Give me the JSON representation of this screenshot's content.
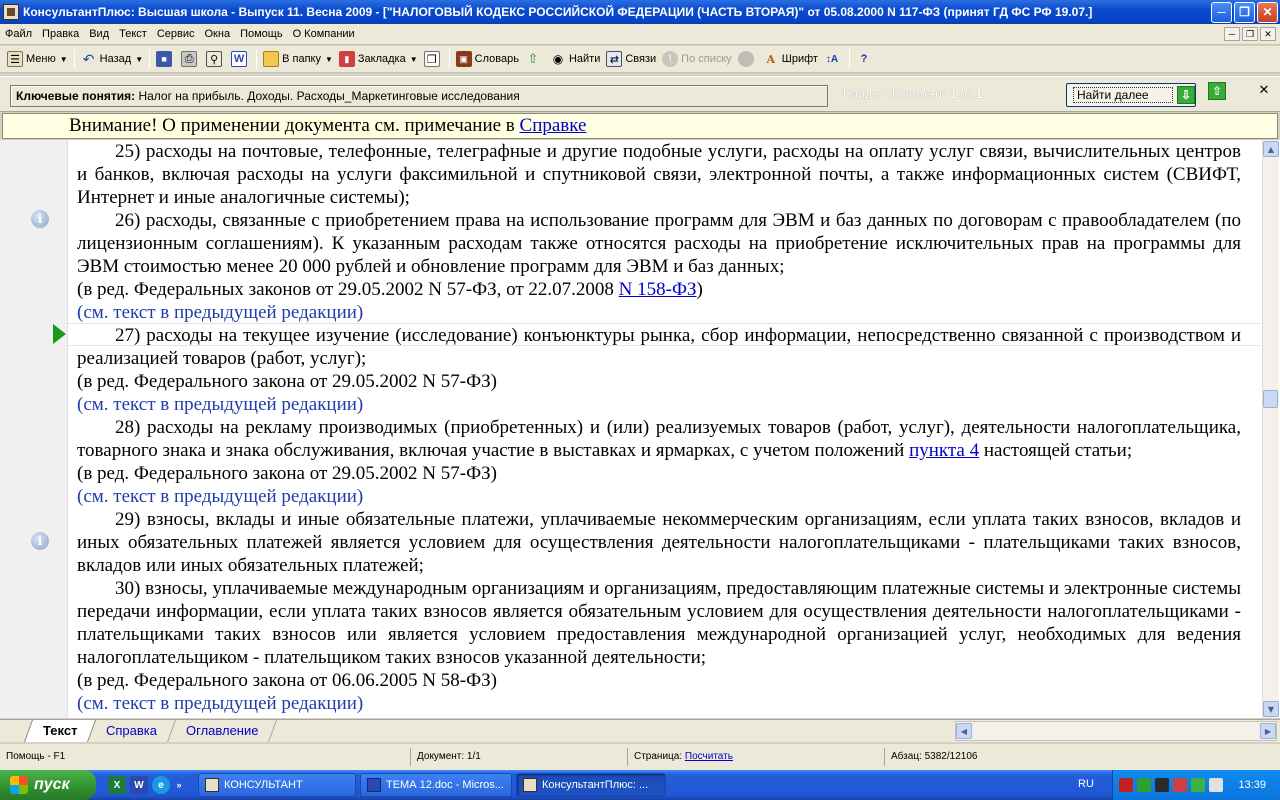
{
  "window": {
    "title": "КонсультантПлюс: Высшая школа - Выпуск 11. Весна 2009 - [\"НАЛОГОВЫЙ КОДЕКС РОССИЙСКОЙ ФЕДЕРАЦИИ (ЧАСТЬ ВТОРАЯ)\" от 05.08.2000 N 117-ФЗ (принят ГД ФС РФ 19.07.]"
  },
  "menu": [
    "Файл",
    "Правка",
    "Вид",
    "Текст",
    "Сервис",
    "Окна",
    "Помощь",
    "О Компании"
  ],
  "toolbar": {
    "menu": "Меню",
    "back": "Назад",
    "to_folder": "В папку",
    "bookmark": "Закладка",
    "dictionary": "Словарь",
    "find": "Найти",
    "links": "Связи",
    "by_list": "По списку",
    "font": "Шрифт"
  },
  "search": {
    "label": "Ключевые понятия:",
    "query": "Налог на прибыль. Доходы. Расходы_Маркетинговые исследования",
    "found_prefix": "Найден фрагмент:",
    "found_current": "1",
    "found_of": "из",
    "found_total": "1",
    "find_next": "Найти далее"
  },
  "attention": {
    "text": "Внимание! О применении документа см. примечание в",
    "link": "Справке"
  },
  "document": {
    "p25": "25) расходы на почтовые, телефонные, телеграфные и другие подобные услуги, расходы на оплату услуг связи, вычислительных центров и банков, включая расходы на услуги факсимильной и спутниковой связи, электронной почты, а также информационных систем (СВИФТ, Интернет и иные аналогичные системы);",
    "p26": "26) расходы, связанные с приобретением права на использование программ для ЭВМ и баз данных по договорам с правообладателем (по лицензионным соглашениям). К указанным расходам также относятся расходы на приобретение исключительных прав на программы для ЭВМ стоимостью менее 20 000 рублей и обновление программ для ЭВМ и баз данных;",
    "p26_red_pre": "(в ред. Федеральных законов от 29.05.2002 N 57-ФЗ, от 22.07.2008",
    "p26_red_link": "N 158-ФЗ",
    "p26_red_post": ")",
    "prev_edition": "(см. текст в предыдущей редакции)",
    "p27": "27) расходы на текущее изучение (исследование) конъюнктуры рынка, сбор информации, непосредственно связанной с производством и реализацией товаров (работ, услуг);",
    "red_57": "(в ред. Федерального закона от 29.05.2002 N 57-ФЗ)",
    "p28_pre": "28) расходы на рекламу производимых (приобретенных) и (или) реализуемых товаров (работ, услуг), деятельности налогоплательщика, товарного знака и знака обслуживания, включая участие в выставках и ярмарках, с учетом положений",
    "p28_link": "пункта 4",
    "p28_post": "настоящей статьи;",
    "p29": "29) взносы, вклады и иные обязательные платежи, уплачиваемые некоммерческим организациям, если уплата таких взносов, вкладов и иных обязательных платежей является условием для осуществления деятельности налогоплательщиками - плательщиками таких взносов, вкладов или иных обязательных платежей;",
    "p30": "30) взносы, уплачиваемые международным организациям и организациям, предоставляющим платежные системы и электронные системы передачи информации, если уплата таких взносов является обязательным условием для осуществления деятельности налогоплательщиками - плательщиками таких взносов или является условием предоставления международной организацией услуг, необходимых для ведения налогоплательщиком - плательщиком таких взносов указанной деятельности;",
    "red_58": "(в ред. Федерального закона от 06.06.2005 N 58-ФЗ)"
  },
  "tabs": [
    "Текст",
    "Справка",
    "Оглавление"
  ],
  "status": {
    "help": "Помощь - F1",
    "document": "Документ: 1/1",
    "page_label": "Страница:",
    "page_link": "Посчитать",
    "paragraph": "Абзац: 5382/12106"
  },
  "taskbar": {
    "start": "пуск",
    "tasks": [
      "КОНСУЛЬТАНТ",
      "ТЕМА 12.doc - Micros...",
      "КонсультантПлюс: ..."
    ],
    "lang": "RU",
    "clock": "13:39"
  }
}
